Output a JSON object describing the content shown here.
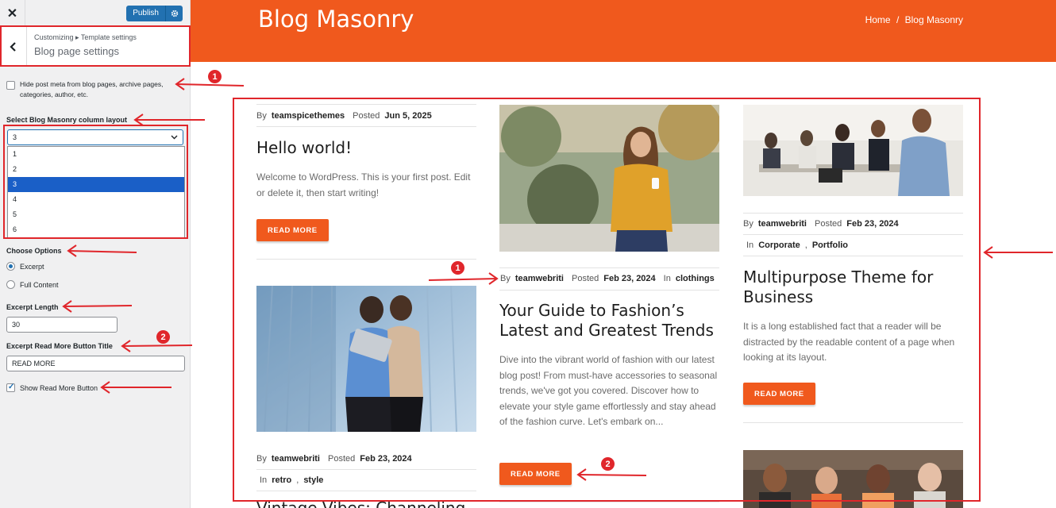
{
  "customizer": {
    "close_label": "✕",
    "publish_label": "Publish",
    "back_label": "‹",
    "breadcrumb": "Customizing ▸ Template settings",
    "section_title": "Blog page settings",
    "hide_meta_label": "Hide post meta from blog pages, archive pages, categories, author, etc.",
    "hide_meta_checked": false,
    "column_layout_label": "Select Blog Masonry column layout",
    "column_layout_value": "3",
    "column_layout_options": [
      "1",
      "2",
      "3",
      "4",
      "5",
      "6"
    ],
    "choose_options_label": "Choose Options",
    "option_excerpt": "Excerpt",
    "option_full": "Full Content",
    "excerpt_length_label": "Excerpt Length",
    "excerpt_length_value": "30",
    "read_more_title_label": "Excerpt Read More Button Title",
    "read_more_title_value": "READ MORE",
    "show_read_more_label": "Show Read More Button",
    "show_read_more_checked": true
  },
  "preview": {
    "page_title": "Blog Masonry",
    "breadcrumb": {
      "home": "Home",
      "sep": "/",
      "current": "Blog Masonry"
    },
    "by": "By",
    "posted": "Posted",
    "in": "In",
    "read_more": "READ MORE",
    "posts": {
      "hello": {
        "author": "teamspicethemes",
        "date": "Jun 5, 2025",
        "title": "Hello world!",
        "excerpt": "Welcome to WordPress. This is your first post. Edit or delete it, then start writing!"
      },
      "fashion": {
        "author": "teamwebriti",
        "date": "Feb 23, 2024",
        "category": "clothings",
        "title": "Your Guide to Fashion’s Latest and Greatest Trends",
        "excerpt": "Dive into the vibrant world of fashion with our latest blog post! From must-have accessories to seasonal trends, we've got you covered. Discover how to elevate your style game effortlessly and stay ahead of the fashion curve. Let's embark on..."
      },
      "business": {
        "author": "teamwebriti",
        "date": "Feb 23, 2024",
        "categories": [
          "Corporate",
          "Portfolio"
        ],
        "title": "Multipurpose Theme for Business",
        "excerpt": "It is a long established fact that a reader will be distracted by the readable content of a page when looking at its layout."
      },
      "retro": {
        "author": "teamwebriti",
        "date": "Feb 23, 2024",
        "categories": [
          "retro",
          "style"
        ],
        "title_partial": "Vintage Vibes: Channeling"
      }
    }
  },
  "annotations": {
    "badge_1": "1",
    "badge_2": "2"
  },
  "colors": {
    "accent": "#f0591d",
    "wp_blue": "#2271b1",
    "annotation_red": "#e0262b"
  }
}
